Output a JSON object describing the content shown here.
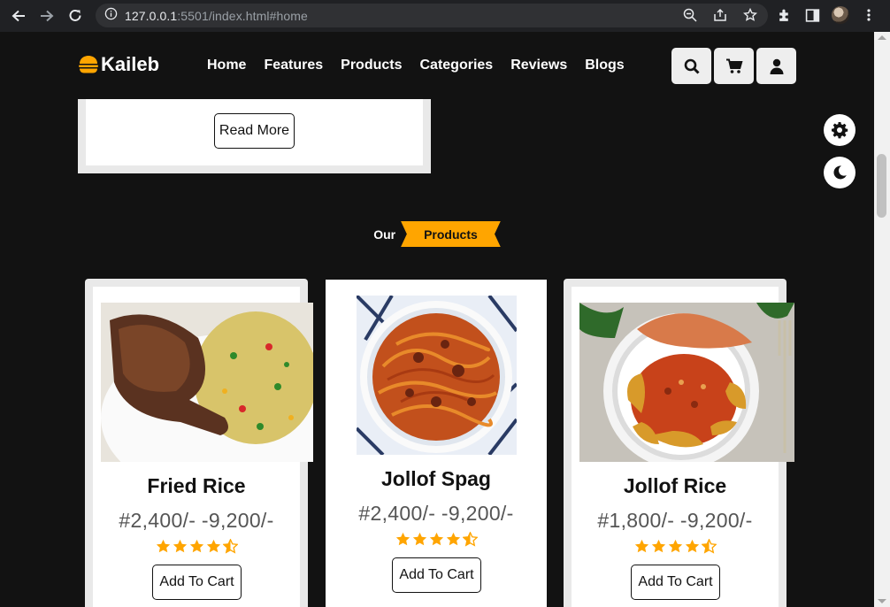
{
  "browser": {
    "url_host": "127.0.0.1",
    "url_rest": ":5501/index.html#home"
  },
  "brand": {
    "name": "Kaileb",
    "accent": "#ffa500"
  },
  "nav": {
    "items": [
      "Home",
      "Features",
      "Products",
      "Categories",
      "Reviews",
      "Blogs"
    ]
  },
  "header_icons": [
    "search-icon",
    "cart-icon",
    "user-icon"
  ],
  "floating": [
    "gear-icon",
    "moon-icon"
  ],
  "blog": {
    "read_more_label": "Read More"
  },
  "section": {
    "prefix": "Our",
    "ribbon": "Products"
  },
  "products": [
    {
      "name": "Fried Rice",
      "price": "#2,400/- -9,200/-",
      "rating": 4.5,
      "cta": "Add To Cart"
    },
    {
      "name": "Jollof Spag",
      "price": "#2,400/- -9,200/-",
      "rating": 4.5,
      "cta": "Add To Cart"
    },
    {
      "name": "Jollof Rice",
      "price": "#1,800/- -9,200/-",
      "rating": 4.5,
      "cta": "Add To Cart"
    }
  ]
}
